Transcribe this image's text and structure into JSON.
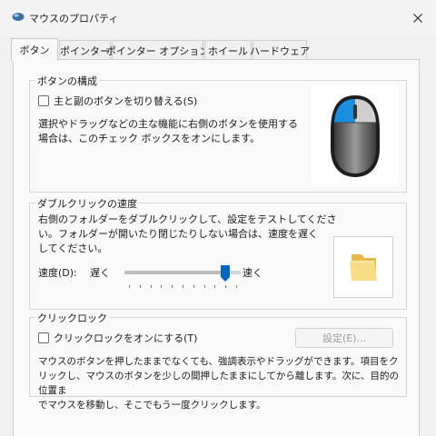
{
  "window": {
    "title": "マウスのプロパティ",
    "title_icon": "mouse-icon",
    "close_icon": "close-icon"
  },
  "tabs": [
    {
      "label": "ボタン",
      "active": true
    },
    {
      "label": "ポインター",
      "active": false
    },
    {
      "label": "ポインター オプション",
      "active": false
    },
    {
      "label": "ホイール",
      "active": false
    },
    {
      "label": "ハードウェア",
      "active": false
    }
  ],
  "button_config": {
    "legend": "ボタンの構成",
    "swap_label": "主と副のボタンを切り替える(S)",
    "swap_checked": false,
    "desc_line1": "選択やドラッグなどの主な機能に右側のボタンを使用する",
    "desc_line2": "場合は、このチェック ボックスをオンにします。",
    "image": "mouse-image"
  },
  "double_click": {
    "legend": "ダブルクリックの速度",
    "desc_line1": "右側のフォルダーをダブルクリックして、設定をテストしてくださ",
    "desc_line2": "い。フォルダーが開いたり閉じたりしない場合は、速度を遅く",
    "desc_line3": "してください。",
    "speed_label": "速度(D):",
    "slow_label": "遅く",
    "fast_label": "速く",
    "speed_value": 0.9,
    "tick_count": 11,
    "test_icon": "folder-icon"
  },
  "click_lock": {
    "legend": "クリックロック",
    "enable_label": "クリックロックをオンにする(T)",
    "enable_checked": false,
    "settings_label": "設定(E)...",
    "desc_line1": "マウスのボタンを押したままでなくても、強調表示やドラッグができます。項目をク",
    "desc_line2": "リックし、マウスのボタンを少しの間押したままにしてから離します。次に、目的の位置ま",
    "desc_line3": "でマウスを移動し、そこでもう一度クリックします。"
  },
  "colors": {
    "accent": "#0067c0",
    "mouse_blue": "#1a8fe0",
    "folder": "#f2d36b"
  }
}
